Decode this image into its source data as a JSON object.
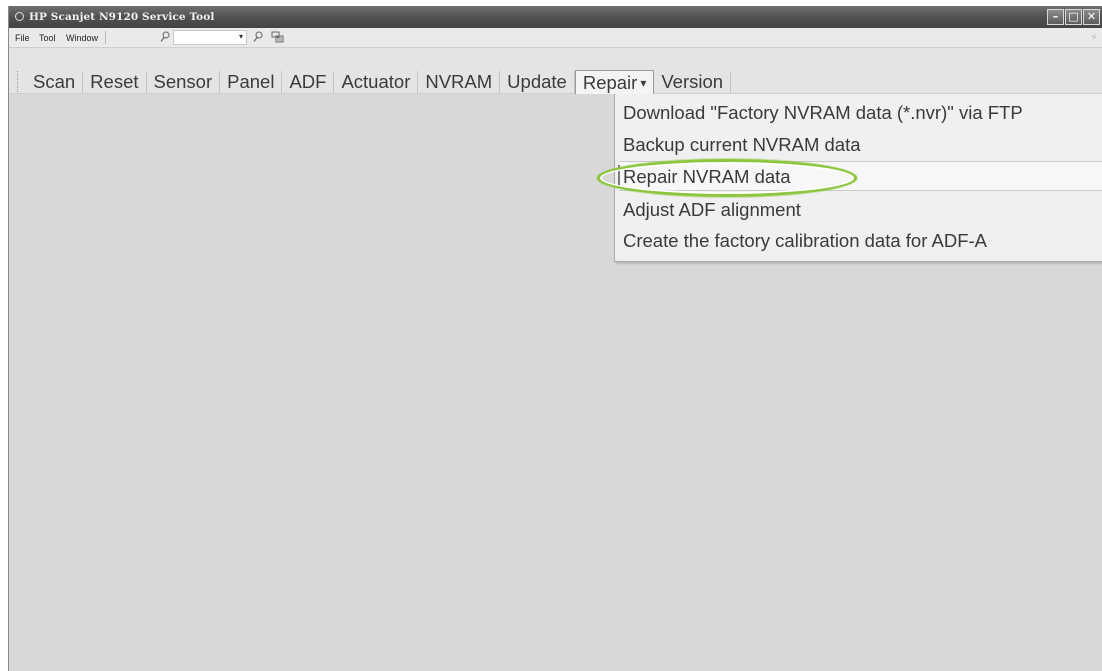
{
  "window": {
    "title": "HP Scanjet N9120 Service Tool",
    "buttons": [
      "minimize",
      "maximize",
      "close"
    ]
  },
  "menubar": {
    "items": [
      "File",
      "Tool",
      "Window"
    ],
    "icons": [
      "search-icon",
      "search-icon",
      "toolbar-icon"
    ],
    "combo_value": ""
  },
  "tabs": [
    {
      "label": "Scan"
    },
    {
      "label": "Reset"
    },
    {
      "label": "Sensor"
    },
    {
      "label": "Panel"
    },
    {
      "label": "ADF"
    },
    {
      "label": "Actuator"
    },
    {
      "label": "NVRAM"
    },
    {
      "label": "Update"
    },
    {
      "label": "Repair",
      "active": true
    },
    {
      "label": "Version"
    }
  ],
  "repair_menu": {
    "items": [
      {
        "label": "Download \"Factory NVRAM data (*.nvr)\" via FTP"
      },
      {
        "label": "Backup current NVRAM data"
      },
      {
        "label": "Repair NVRAM data",
        "highlighted": true
      },
      {
        "label": "Adjust ADF alignment"
      },
      {
        "label": "Create the factory calibration data for ADF-A"
      }
    ]
  },
  "callout": {
    "color": "#8cc63e",
    "target": "Repair NVRAM data"
  }
}
